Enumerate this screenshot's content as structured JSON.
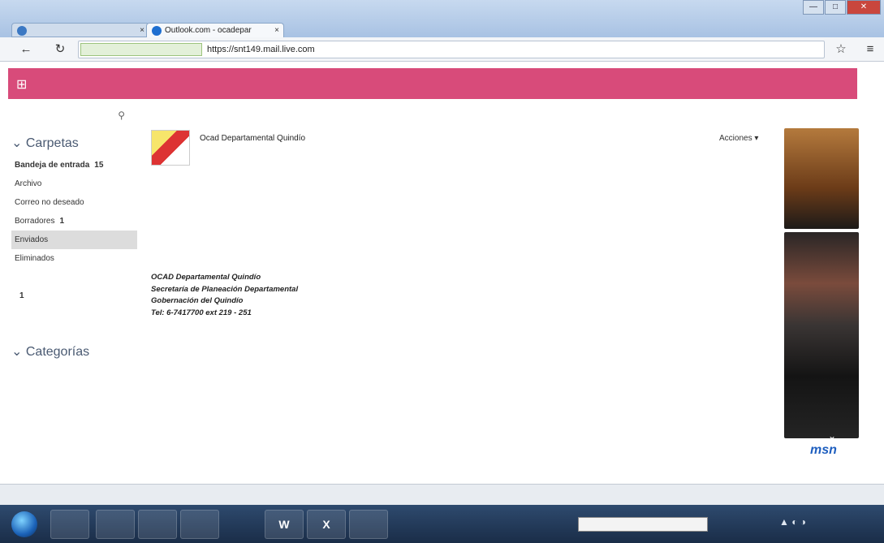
{
  "browser": {
    "tabs": [
      {
        "label": "",
        "active": false
      },
      {
        "label": "Outlook.com - ocadepar",
        "active": true
      }
    ],
    "tab_close_glyph": "×",
    "window_buttons": [
      "—",
      "□",
      "✕"
    ],
    "secure_label": "",
    "url": "https://snt149.mail.live.com",
    "url_rest": "",
    "icons": [
      "back-arrow-icon",
      "reload-icon",
      "star-icon",
      "menu-icon"
    ],
    "star_glyph": "☆",
    "menu_glyph": "≡"
  },
  "outlook_header": {
    "brand": "",
    "commands": [],
    "right_text": "",
    "accent_color": "#d84b7a"
  },
  "folder_pane": {
    "search_placeholder": "",
    "sections": [
      {
        "title": "Carpetas",
        "items": [
          {
            "label": "Bandeja de entrada",
            "count": "15",
            "bold": true
          },
          {
            "label": "Archivo",
            "count": ""
          },
          {
            "label": "Correo no deseado",
            "count": ""
          },
          {
            "label": "Borradores",
            "count": "1"
          },
          {
            "label": "Enviados",
            "count": "",
            "selected": true
          },
          {
            "label": "Eliminados",
            "count": ""
          },
          {
            "label": "",
            "count": ""
          },
          {
            "label": "",
            "count": "1"
          },
          {
            "label": "",
            "count": "",
            "link": true
          }
        ]
      },
      {
        "title": "Categorías",
        "items": [
          {
            "label": "",
            "count": ""
          },
          {
            "label": "",
            "count": "",
            "link": true
          }
        ]
      }
    ]
  },
  "message": {
    "subject": "",
    "subject_tools": "",
    "sender": "Ocad Departamental Quindío",
    "to_line": "",
    "actions_label": "Acciones ▾",
    "body": "",
    "signature_lines": [
      "",
      "OCAD Departamental Quindío",
      "Secretaría de Planeación Departamental",
      "Gobernación del Quindío",
      "Tel: 6-7417700 ext 219 - 251"
    ],
    "footer_links": ""
  },
  "ads": {
    "header": "",
    "items": [
      {
        "caption": ""
      },
      {
        "caption": ""
      }
    ],
    "chevron_glyph": "⌄",
    "brand": "msn"
  },
  "download_bar": {
    "item_label": "",
    "show_all_label": ""
  },
  "taskbar": {
    "apps": [
      "ie",
      "chrome",
      "folder",
      "firefox",
      "word",
      "excel",
      "acrobat"
    ],
    "app_glyphs": [
      "",
      "",
      "",
      "",
      "W",
      "X",
      ""
    ],
    "tray_glyphs": "▲ ◐ ◑"
  }
}
